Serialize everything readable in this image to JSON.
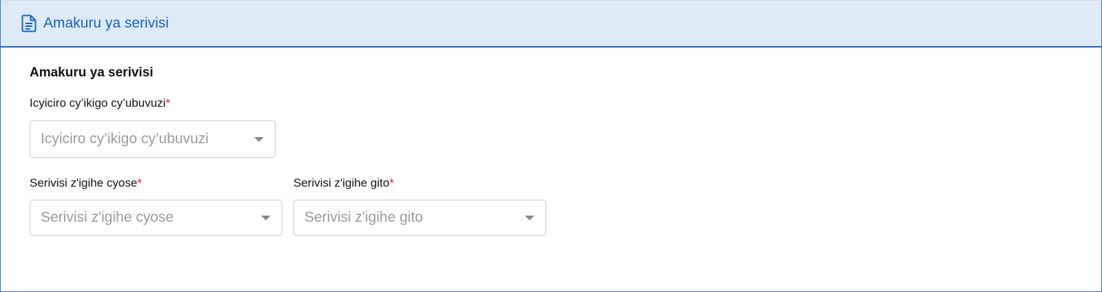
{
  "header": {
    "icon": "document-icon",
    "title": "Amakuru ya serivisi"
  },
  "section": {
    "title": "Amakuru ya serivisi"
  },
  "fields": {
    "facility_category": {
      "label": "Icyiciro cy’ikigo cy’ubuvuzi",
      "required_mark": "*",
      "placeholder": "Icyiciro cy’ikigo cy’ubuvuzi"
    },
    "long_term_services": {
      "label": "Serivisi z'igihe cyose",
      "required_mark": "*",
      "placeholder": "Serivisi z'igihe cyose"
    },
    "short_term_services": {
      "label": "Serivisi z'igihe gito",
      "required_mark": "*",
      "placeholder": "Serivisi z'igihe gito"
    }
  },
  "colors": {
    "header_bg": "#deebf7",
    "accent": "#1560bd",
    "required": "#e0142d"
  }
}
